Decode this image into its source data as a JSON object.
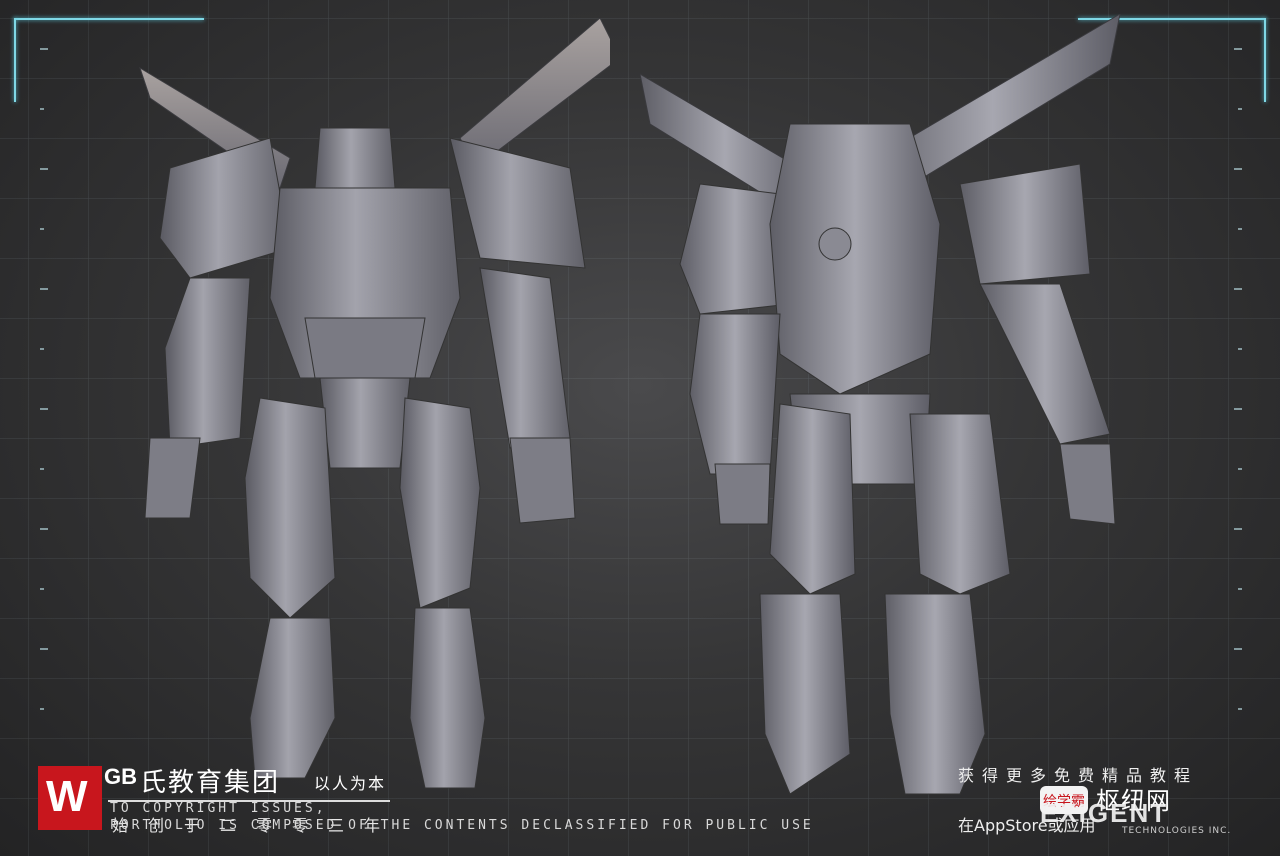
{
  "branding": {
    "logo_letters": "W",
    "logo_mono": "GB",
    "group_name": "氏教育集团",
    "motto": "以人为本",
    "logo_color": "#c8161d"
  },
  "watermark": {
    "line1": "TO COPYRIGHT ISSUES,",
    "line2": "PORTFOLIO IS COMPOSED OF THE CONTENTS DECLASSIFIED FOR PUBLIC USE",
    "cn_overlay": "始创于二零零三年"
  },
  "promo": {
    "line1": "获得更多免费精品教程",
    "badge": "绘学霸",
    "app_name": "枢纽网",
    "line2": "在AppStore或应用",
    "line3": "应用",
    "corp": "EXIGENT",
    "corp_sub": "TECHNOLOGIES INC."
  },
  "colors": {
    "accent_hud": "#7fd8e6",
    "robot_metal": "#8e8e96"
  }
}
